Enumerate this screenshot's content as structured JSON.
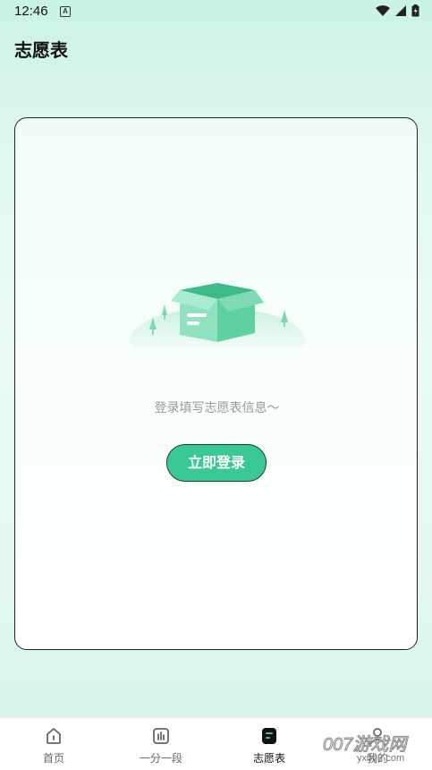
{
  "status_bar": {
    "time": "12:46",
    "notification_letter": "A"
  },
  "header": {
    "title": "志愿表"
  },
  "empty_state": {
    "message": "登录填写志愿表信息～",
    "login_button": "立即登录"
  },
  "tab_bar": {
    "tabs": [
      {
        "label": "首页",
        "icon": "home-icon",
        "active": false
      },
      {
        "label": "一分一段",
        "icon": "chart-icon",
        "active": false
      },
      {
        "label": "志愿表",
        "icon": "form-icon",
        "active": true
      },
      {
        "label": "我的",
        "icon": "profile-icon",
        "active": false
      }
    ]
  },
  "watermark": {
    "brand": "007游戏网",
    "domain": "yx007.com"
  },
  "colors": {
    "accent": "#3ac992",
    "background": "#e4f8f0",
    "tab_active": "#111111"
  }
}
